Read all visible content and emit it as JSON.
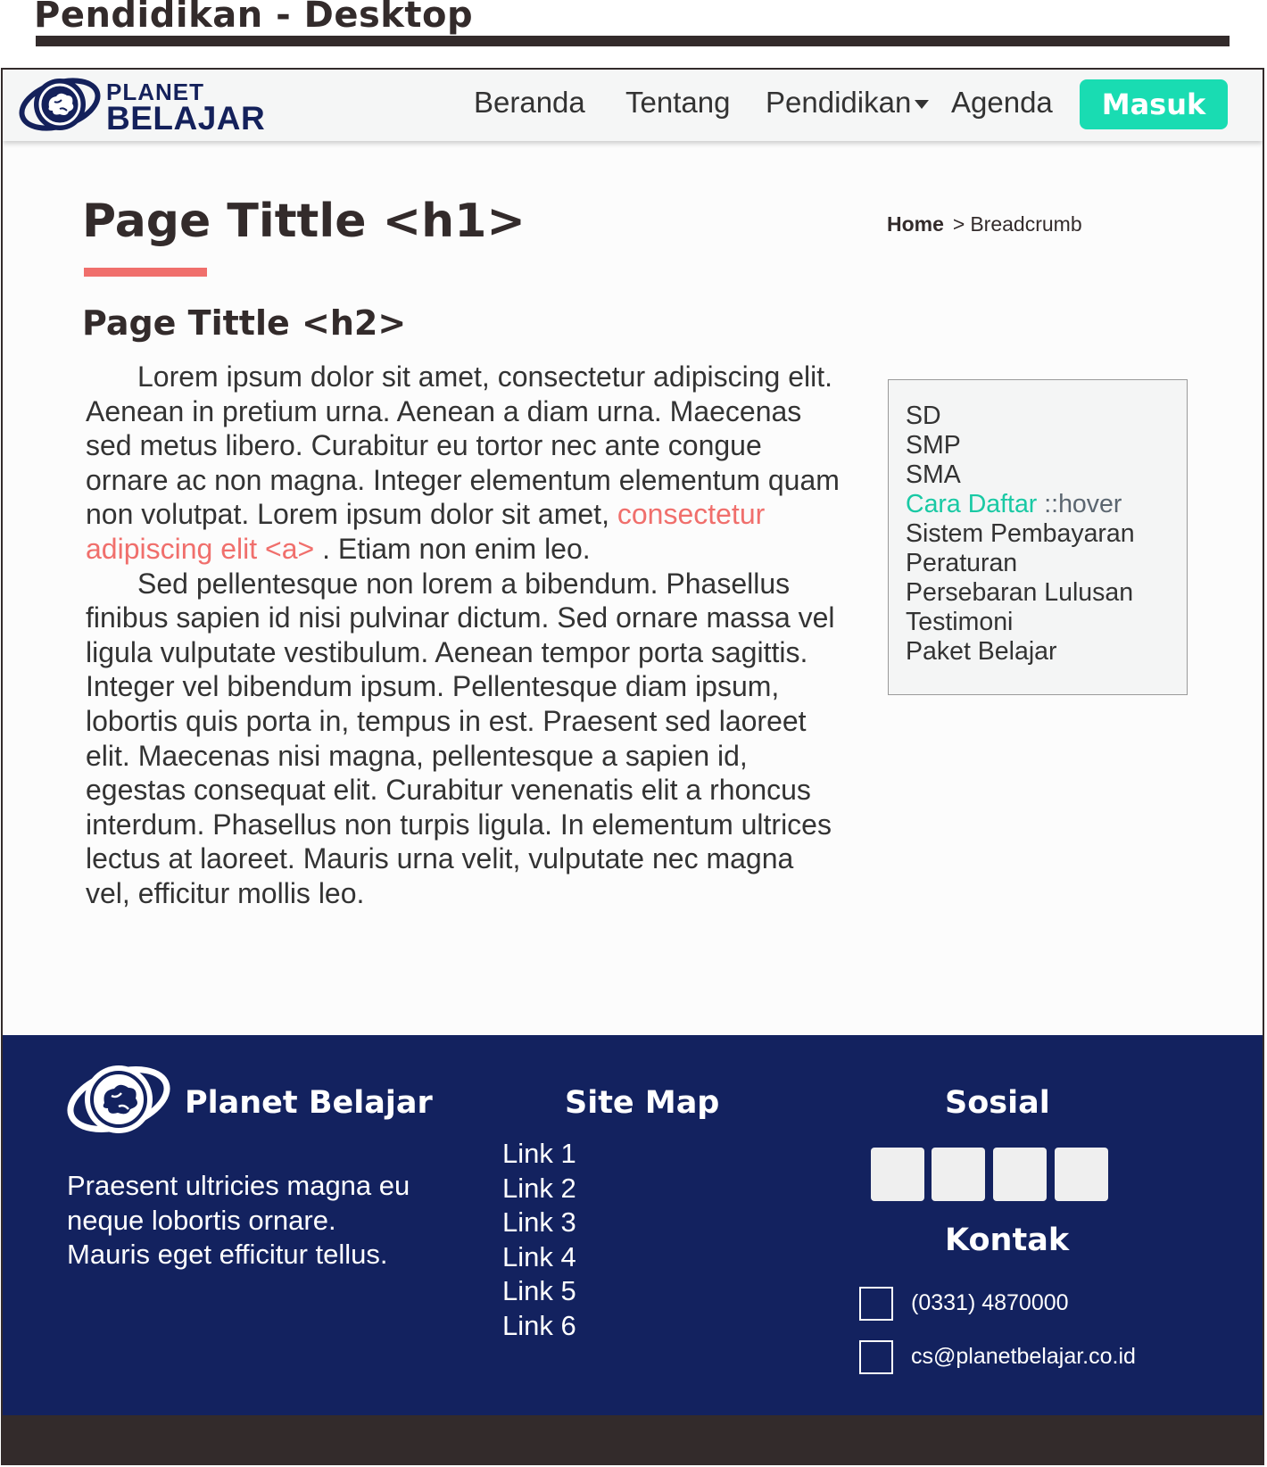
{
  "mockup": {
    "title": "Pendidikan - Desktop"
  },
  "navbar": {
    "logo": {
      "line1": "PLANET",
      "line2": "BELAJAR",
      "icon": "planet-brain-icon"
    },
    "items": [
      {
        "label": "Beranda"
      },
      {
        "label": "Tentang"
      },
      {
        "label": "Pendidikan",
        "has_dropdown": true
      },
      {
        "label": "Agenda"
      }
    ],
    "cta_label": "Masuk"
  },
  "page": {
    "h1": "Page Tittle <h1>",
    "h2": "Page Tittle <h2>",
    "breadcrumb": {
      "home": "Home",
      "separator": ">",
      "current": "Breadcrumb"
    },
    "paragraph1_before_link": "Lorem ipsum dolor sit amet, consectetur adipiscing elit. Aenean in pretium urna. Aenean a diam urna. Maecenas sed metus libero. Curabitur eu tortor nec ante congue ornare ac non magna. Integer elementum elementum quam non volutpat. Lorem ipsum dolor sit amet, ",
    "paragraph1_link": "consectetur adipiscing elit <a>",
    "paragraph1_after_link": " . Etiam non enim leo.",
    "paragraph2": "Sed pellentesque non lorem a bibendum. Phasellus finibus sapien id nisi pulvinar dictum. Sed ornare massa vel ligula vulputate vestibulum. Aenean tempor porta sagittis. Integer vel bibendum ipsum. Pellentesque diam ipsum, lobortis quis porta in, tempus in est. Praesent sed laoreet elit. Maecenas nisi magna, pellentesque a sapien id, egestas consequat elit. Curabitur venenatis elit a rhoncus interdum. Phasellus non turpis ligula. In elementum ultrices lectus at laoreet. Mauris urna velit, vulputate nec magna vel, efficitur mollis leo."
  },
  "side_menu": {
    "items": [
      {
        "label": "SD"
      },
      {
        "label": "SMP"
      },
      {
        "label": "SMA"
      },
      {
        "label": "Cara Daftar",
        "hover_note": " ::hover"
      },
      {
        "label": "Sistem Pembayaran"
      },
      {
        "label": "Peraturan"
      },
      {
        "label": "Persebaran Lulusan"
      },
      {
        "label": "Testimoni"
      },
      {
        "label": "Paket Belajar"
      }
    ]
  },
  "footer": {
    "brand": "Planet Belajar",
    "description": "Praesent ultricies magna eu neque lobortis ornare. Mauris eget efficitur tellus.",
    "sitemap_title": "Site Map",
    "links": [
      "Link 1",
      "Link 2",
      "Link 3",
      "Link 4",
      "Link 5",
      "Link 6"
    ],
    "social_title": "Sosial",
    "social_icons": [
      "social-icon-1",
      "social-icon-2",
      "social-icon-3",
      "social-icon-4"
    ],
    "contact_title": "Kontak",
    "phone": "(0331) 4870000",
    "email": "cs@planetbelajar.co.id"
  },
  "colors": {
    "brand_navy": "#13225f",
    "accent_teal": "#19dcb2",
    "accent_coral": "#f06f6c",
    "dark_text": "#332b2b"
  }
}
